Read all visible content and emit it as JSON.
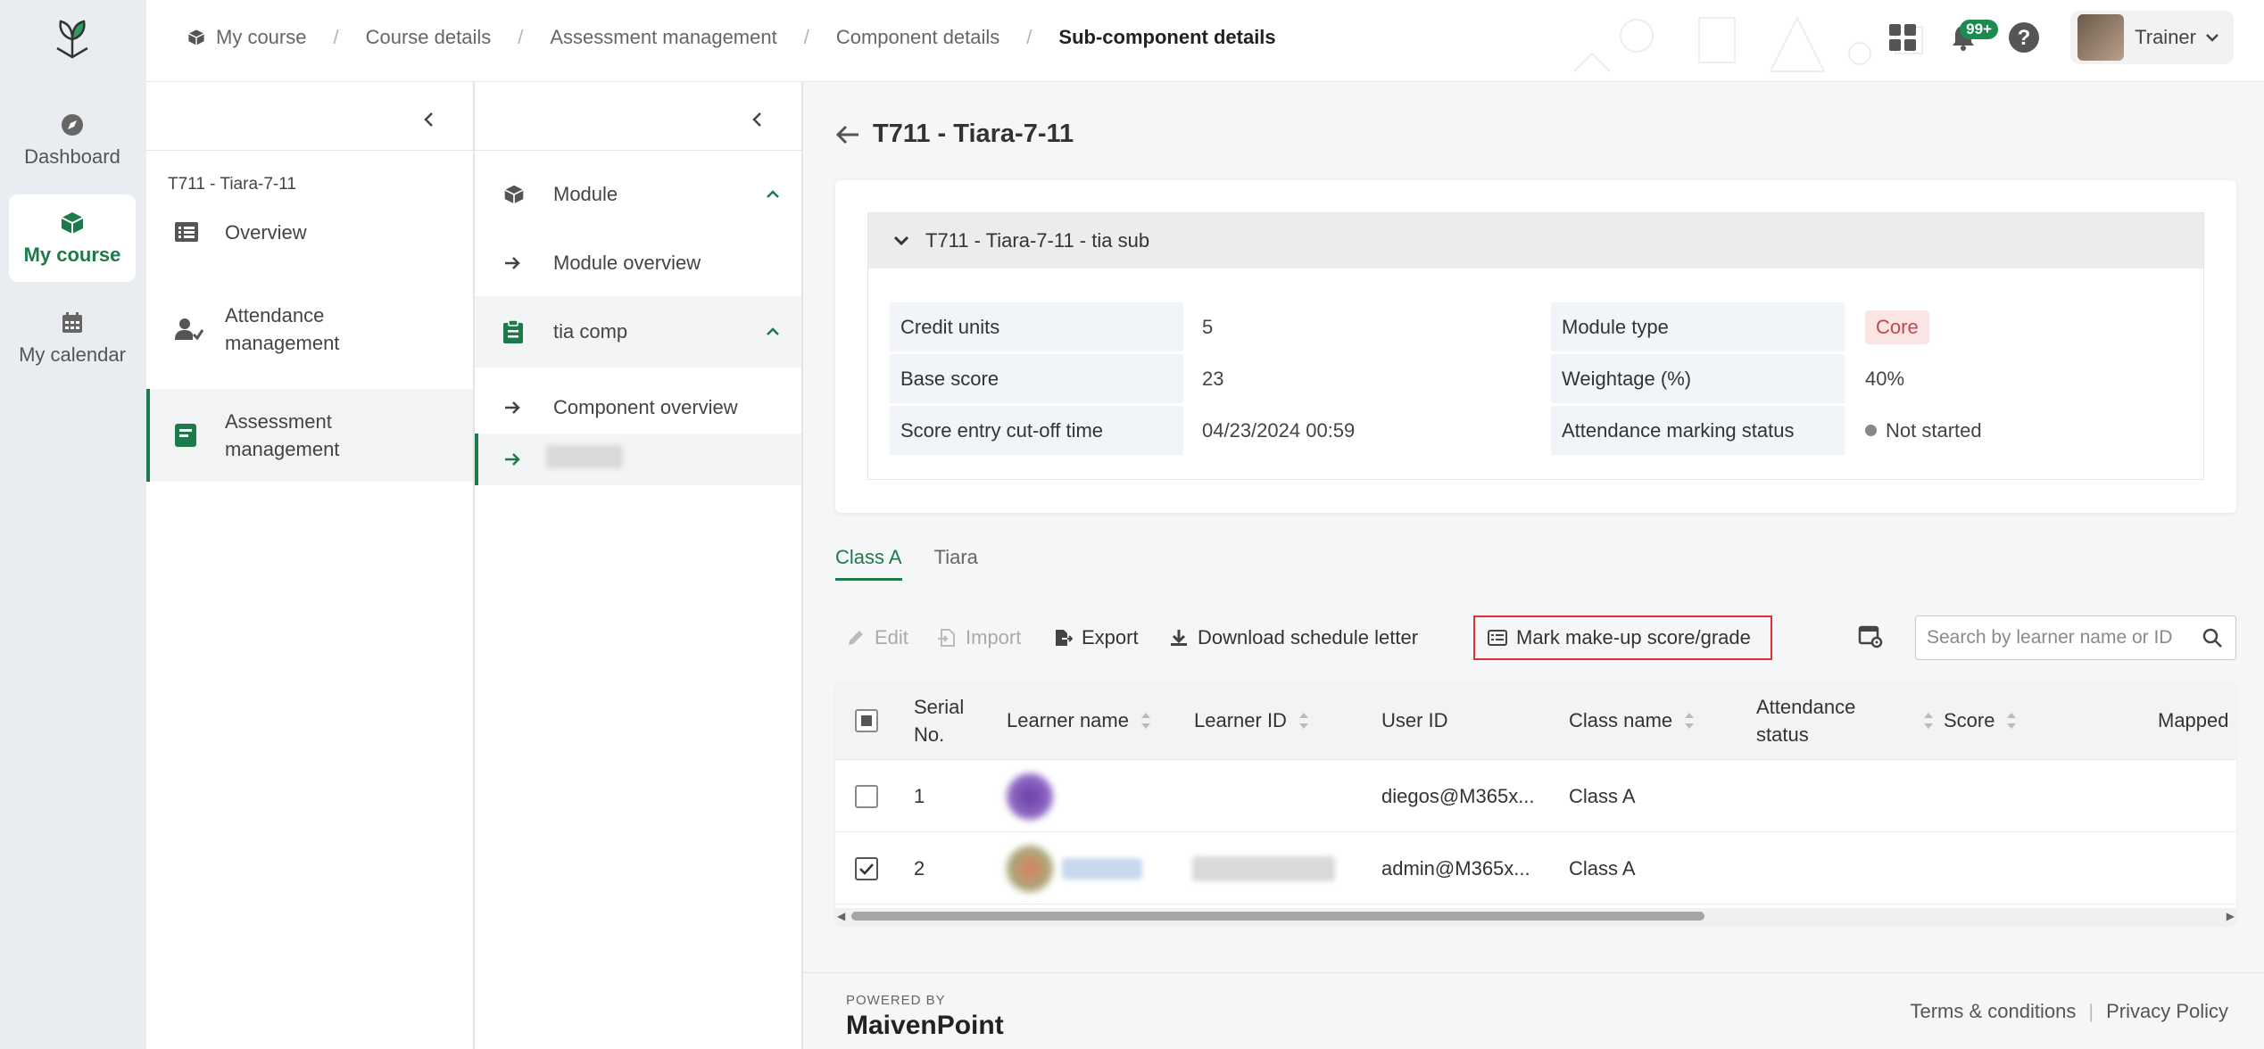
{
  "rail": {
    "items": [
      {
        "label": "Dashboard",
        "icon": "compass-icon"
      },
      {
        "label": "My course",
        "icon": "cube-icon",
        "active": true
      },
      {
        "label": "My calendar",
        "icon": "calendar-icon"
      }
    ]
  },
  "breadcrumb": [
    "My course",
    "Course details",
    "Assessment management",
    "Component details",
    "Sub-component details"
  ],
  "header": {
    "notification_count": "99+",
    "user_name": "Trainer"
  },
  "panel1": {
    "course_code": "T711 - Tiara-7-11",
    "items": [
      {
        "label": "Overview",
        "icon": "list-icon"
      },
      {
        "label": "Attendance management",
        "icon": "user-check-icon"
      },
      {
        "label": "Assessment management",
        "icon": "book-icon",
        "active": true
      }
    ]
  },
  "panel2": {
    "module_label": "Module",
    "module_overview": "Module overview",
    "component_label": "tia comp",
    "component_overview": "Component overview"
  },
  "main": {
    "title": "T711 - Tiara-7-11",
    "accordion_title": "T711 - Tiara-7-11 - tia sub",
    "details": {
      "credit_units_label": "Credit units",
      "credit_units": "5",
      "base_score_label": "Base score",
      "base_score": "23",
      "cutoff_label": "Score entry cut-off time",
      "cutoff": "04/23/2024 00:59",
      "module_type_label": "Module type",
      "module_type": "Core",
      "weightage_label": "Weightage (%)",
      "weightage": "40%",
      "attendance_status_label": "Attendance marking status",
      "attendance_status": "Not started"
    },
    "tabs": [
      "Class A",
      "Tiara"
    ],
    "toolbar": {
      "edit": "Edit",
      "import": "Import",
      "export": "Export",
      "download": "Download schedule letter",
      "makeup": "Mark make-up score/grade"
    },
    "search_placeholder": "Search by learner name or ID",
    "columns": {
      "serial_1": "Serial",
      "serial_2": "No.",
      "learner_name": "Learner name",
      "learner_id": "Learner ID",
      "user_id": "User ID",
      "class_name": "Class name",
      "attendance_1": "Attendance",
      "attendance_2": "status",
      "score": "Score",
      "mapped": "Mapped"
    },
    "rows": [
      {
        "serial": "1",
        "user_id": "diegos@M365x...",
        "class_name": "Class A",
        "checked": false
      },
      {
        "serial": "2",
        "user_id": "admin@M365x...",
        "class_name": "Class A",
        "checked": true
      }
    ]
  },
  "footer": {
    "powered_by": "POWERED BY",
    "brand": "MaivenPoint",
    "terms": "Terms & conditions",
    "privacy": "Privacy Policy"
  }
}
